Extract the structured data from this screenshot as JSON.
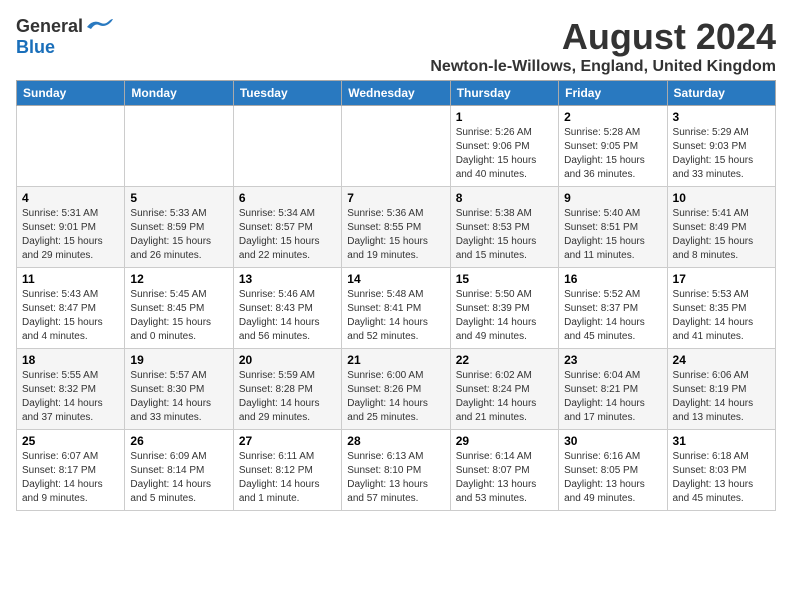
{
  "header": {
    "logo_general": "General",
    "logo_blue": "Blue",
    "month_title": "August 2024",
    "location": "Newton-le-Willows, England, United Kingdom"
  },
  "weekdays": [
    "Sunday",
    "Monday",
    "Tuesday",
    "Wednesday",
    "Thursday",
    "Friday",
    "Saturday"
  ],
  "weeks": [
    [
      {
        "day": "",
        "info": ""
      },
      {
        "day": "",
        "info": ""
      },
      {
        "day": "",
        "info": ""
      },
      {
        "day": "",
        "info": ""
      },
      {
        "day": "1",
        "info": "Sunrise: 5:26 AM\nSunset: 9:06 PM\nDaylight: 15 hours\nand 40 minutes."
      },
      {
        "day": "2",
        "info": "Sunrise: 5:28 AM\nSunset: 9:05 PM\nDaylight: 15 hours\nand 36 minutes."
      },
      {
        "day": "3",
        "info": "Sunrise: 5:29 AM\nSunset: 9:03 PM\nDaylight: 15 hours\nand 33 minutes."
      }
    ],
    [
      {
        "day": "4",
        "info": "Sunrise: 5:31 AM\nSunset: 9:01 PM\nDaylight: 15 hours\nand 29 minutes."
      },
      {
        "day": "5",
        "info": "Sunrise: 5:33 AM\nSunset: 8:59 PM\nDaylight: 15 hours\nand 26 minutes."
      },
      {
        "day": "6",
        "info": "Sunrise: 5:34 AM\nSunset: 8:57 PM\nDaylight: 15 hours\nand 22 minutes."
      },
      {
        "day": "7",
        "info": "Sunrise: 5:36 AM\nSunset: 8:55 PM\nDaylight: 15 hours\nand 19 minutes."
      },
      {
        "day": "8",
        "info": "Sunrise: 5:38 AM\nSunset: 8:53 PM\nDaylight: 15 hours\nand 15 minutes."
      },
      {
        "day": "9",
        "info": "Sunrise: 5:40 AM\nSunset: 8:51 PM\nDaylight: 15 hours\nand 11 minutes."
      },
      {
        "day": "10",
        "info": "Sunrise: 5:41 AM\nSunset: 8:49 PM\nDaylight: 15 hours\nand 8 minutes."
      }
    ],
    [
      {
        "day": "11",
        "info": "Sunrise: 5:43 AM\nSunset: 8:47 PM\nDaylight: 15 hours\nand 4 minutes."
      },
      {
        "day": "12",
        "info": "Sunrise: 5:45 AM\nSunset: 8:45 PM\nDaylight: 15 hours\nand 0 minutes."
      },
      {
        "day": "13",
        "info": "Sunrise: 5:46 AM\nSunset: 8:43 PM\nDaylight: 14 hours\nand 56 minutes."
      },
      {
        "day": "14",
        "info": "Sunrise: 5:48 AM\nSunset: 8:41 PM\nDaylight: 14 hours\nand 52 minutes."
      },
      {
        "day": "15",
        "info": "Sunrise: 5:50 AM\nSunset: 8:39 PM\nDaylight: 14 hours\nand 49 minutes."
      },
      {
        "day": "16",
        "info": "Sunrise: 5:52 AM\nSunset: 8:37 PM\nDaylight: 14 hours\nand 45 minutes."
      },
      {
        "day": "17",
        "info": "Sunrise: 5:53 AM\nSunset: 8:35 PM\nDaylight: 14 hours\nand 41 minutes."
      }
    ],
    [
      {
        "day": "18",
        "info": "Sunrise: 5:55 AM\nSunset: 8:32 PM\nDaylight: 14 hours\nand 37 minutes."
      },
      {
        "day": "19",
        "info": "Sunrise: 5:57 AM\nSunset: 8:30 PM\nDaylight: 14 hours\nand 33 minutes."
      },
      {
        "day": "20",
        "info": "Sunrise: 5:59 AM\nSunset: 8:28 PM\nDaylight: 14 hours\nand 29 minutes."
      },
      {
        "day": "21",
        "info": "Sunrise: 6:00 AM\nSunset: 8:26 PM\nDaylight: 14 hours\nand 25 minutes."
      },
      {
        "day": "22",
        "info": "Sunrise: 6:02 AM\nSunset: 8:24 PM\nDaylight: 14 hours\nand 21 minutes."
      },
      {
        "day": "23",
        "info": "Sunrise: 6:04 AM\nSunset: 8:21 PM\nDaylight: 14 hours\nand 17 minutes."
      },
      {
        "day": "24",
        "info": "Sunrise: 6:06 AM\nSunset: 8:19 PM\nDaylight: 14 hours\nand 13 minutes."
      }
    ],
    [
      {
        "day": "25",
        "info": "Sunrise: 6:07 AM\nSunset: 8:17 PM\nDaylight: 14 hours\nand 9 minutes."
      },
      {
        "day": "26",
        "info": "Sunrise: 6:09 AM\nSunset: 8:14 PM\nDaylight: 14 hours\nand 5 minutes."
      },
      {
        "day": "27",
        "info": "Sunrise: 6:11 AM\nSunset: 8:12 PM\nDaylight: 14 hours\nand 1 minute."
      },
      {
        "day": "28",
        "info": "Sunrise: 6:13 AM\nSunset: 8:10 PM\nDaylight: 13 hours\nand 57 minutes."
      },
      {
        "day": "29",
        "info": "Sunrise: 6:14 AM\nSunset: 8:07 PM\nDaylight: 13 hours\nand 53 minutes."
      },
      {
        "day": "30",
        "info": "Sunrise: 6:16 AM\nSunset: 8:05 PM\nDaylight: 13 hours\nand 49 minutes."
      },
      {
        "day": "31",
        "info": "Sunrise: 6:18 AM\nSunset: 8:03 PM\nDaylight: 13 hours\nand 45 minutes."
      }
    ]
  ]
}
